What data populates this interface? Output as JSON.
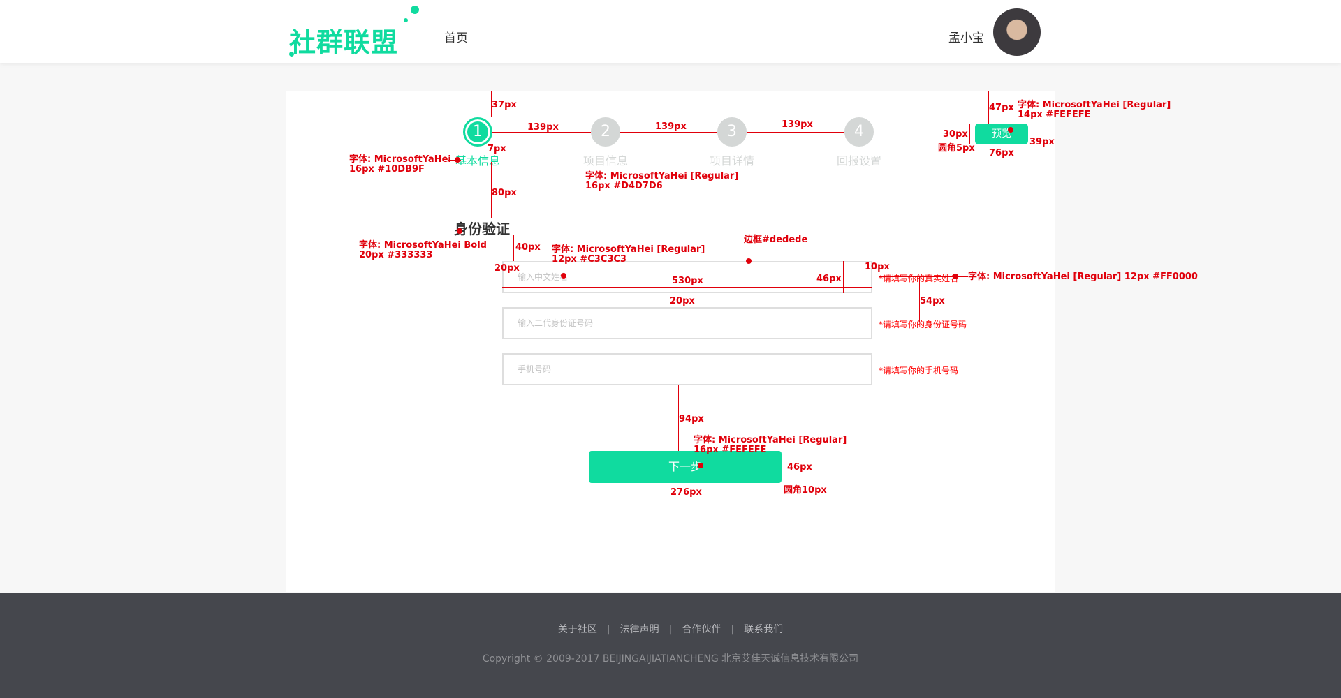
{
  "header": {
    "logo_text": "社群联盟",
    "nav_home": "首页",
    "username": "孟小宝"
  },
  "steps": [
    {
      "number": "1",
      "label": "基本信息",
      "active": true
    },
    {
      "number": "2",
      "label": "项目信息",
      "active": false
    },
    {
      "number": "3",
      "label": "项目详情",
      "active": false
    },
    {
      "number": "4",
      "label": "回报设置",
      "active": false
    }
  ],
  "preview_button": "预览",
  "section_title": "身份验证",
  "form": {
    "name_placeholder": "输入中文姓名",
    "name_hint": "*请填写你的真实姓名",
    "id_placeholder": "输入二代身份证号码",
    "id_hint": "*请填写你的身份证号码",
    "phone_placeholder": "手机号码",
    "phone_hint": "*请填写你的手机号码"
  },
  "next_button": "下一步",
  "annotations": {
    "gap_37": "37px",
    "gap_139_a": "139px",
    "gap_139_b": "139px",
    "gap_139_c": "139px",
    "gap_7": "7px",
    "gap_80": "80px",
    "font_active_1": "字体: MicrosoftYaHei",
    "font_active_2": "16px #10DB9F",
    "font_inactive_1": "字体: MicrosoftYaHei [Regular]",
    "font_inactive_2": "16px #D4D7D6",
    "gap_47": "47px",
    "font_preview_1": "字体: MicrosoftYaHei [Regular]",
    "font_preview_2": "14px #FEFEFE",
    "gap_30": "30px",
    "radius_5": "圆角5px",
    "width_76": "76px",
    "gap_39": "39px",
    "font_title_1": "字体: MicrosoftYaHei Bold",
    "font_title_2": "20px #333333",
    "gap_40": "40px",
    "font_placeholder_1": "字体: MicrosoftYaHei [Regular]",
    "font_placeholder_2": "12px #C3C3C3",
    "border": "边框#dedede",
    "gap_20_a": "20px",
    "width_530": "530px",
    "height_46_a": "46px",
    "gap_10": "10px",
    "font_hint": "字体: MicrosoftYaHei [Regular] 12px #FF0000",
    "gap_20_b": "20px",
    "gap_54": "54px",
    "gap_94": "94px",
    "font_next_1": "字体: MicrosoftYaHei [Regular]",
    "font_next_2": "16px #FEFEFE",
    "height_46_b": "46px",
    "width_276": "276px",
    "radius_10": "圆角10px"
  },
  "footer": {
    "links": [
      "关于社区",
      "法律声明",
      "合作伙伴",
      "联系我们"
    ],
    "separator": "|",
    "copyright": "Copyright © 2009-2017 BEIJINGAIJIATIANCHENG 北京艾佳天诚信息技术有限公司"
  },
  "colors": {
    "accent": "#10DB9F",
    "inactive": "#D4D7D6",
    "annotation": "#E0000B",
    "footer_bg": "#45474D"
  }
}
